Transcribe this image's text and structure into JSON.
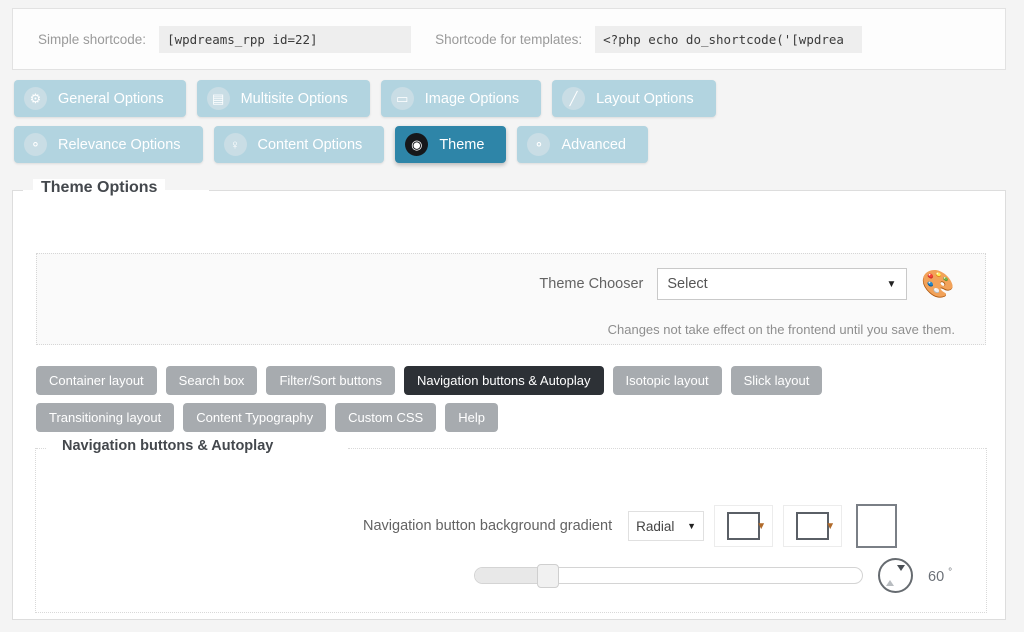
{
  "shortcode_bar": {
    "simple_label": "Simple shortcode:",
    "simple_value": "[wpdreams_rpp id=22]",
    "template_label": "Shortcode for templates:",
    "template_value": "<?php echo do_shortcode('[wpdrea"
  },
  "tabs": {
    "row1": [
      {
        "label": "General Options",
        "icon": "gear-icon",
        "glyph": "⚙",
        "active": false
      },
      {
        "label": "Multisite Options",
        "icon": "sites-icon",
        "glyph": "▤",
        "active": false
      },
      {
        "label": "Image Options",
        "icon": "image-icon",
        "glyph": "▭",
        "active": false
      },
      {
        "label": "Layout Options",
        "icon": "pencil-icon",
        "glyph": "╱",
        "active": false
      }
    ],
    "row2": [
      {
        "label": "Relevance Options",
        "icon": "relevance-icon",
        "glyph": "⚬",
        "active": false
      },
      {
        "label": "Content Options",
        "icon": "pin-icon",
        "glyph": "♀",
        "active": false
      },
      {
        "label": "Theme",
        "icon": "eye-icon",
        "glyph": "◉",
        "active": true
      },
      {
        "label": "Advanced",
        "icon": "advanced-icon",
        "glyph": "⚬",
        "active": false
      }
    ]
  },
  "theme_options": {
    "legend": "Theme Options",
    "chooser_label": "Theme Chooser",
    "chooser_value": "Select",
    "chooser_caret": "▼",
    "palette_glyph": "🎨",
    "note": "Changes not take effect on the frontend until you save them."
  },
  "subtabs": {
    "row1": [
      {
        "label": "Container layout",
        "active": false
      },
      {
        "label": "Search box",
        "active": false
      },
      {
        "label": "Filter/Sort buttons",
        "active": false
      },
      {
        "label": "Navigation buttons & Autoplay",
        "active": true
      },
      {
        "label": "Isotopic layout",
        "active": false
      },
      {
        "label": "Slick layout",
        "active": false
      }
    ],
    "row2": [
      {
        "label": "Transitioning layout",
        "active": false
      },
      {
        "label": "Content Typography",
        "active": false
      },
      {
        "label": "Custom CSS",
        "active": false
      },
      {
        "label": "Help",
        "active": false
      }
    ]
  },
  "nav_section": {
    "legend": "Navigation buttons & Autoplay",
    "gradient_label": "Navigation button background gradient",
    "gradient_type": "Radial",
    "gradient_caret": "▼",
    "color_caret": "▼",
    "color_1": "#ffffff",
    "color_2": "#ffffff",
    "color_3": "#ffffff",
    "angle_value": "60",
    "angle_unit": "°",
    "slider_percent": 18
  }
}
